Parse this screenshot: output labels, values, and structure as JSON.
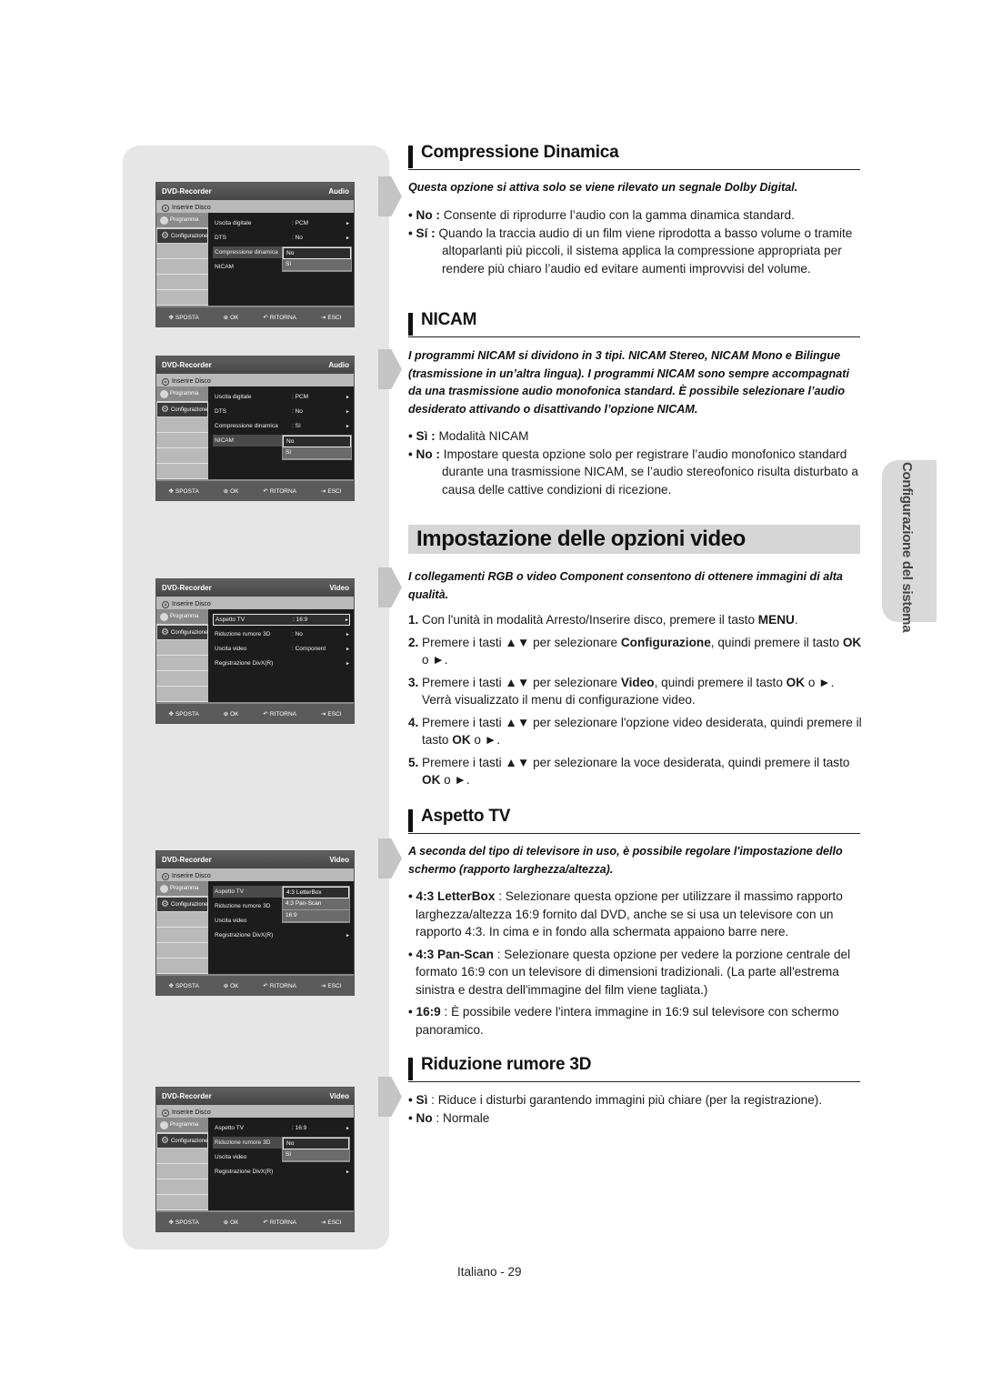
{
  "page": {
    "side_tab": "Configurazione del sistema",
    "page_number": "Italiano - 29"
  },
  "osd_common": {
    "app_title": "DVD-Recorder",
    "disc_label": "Inserire Disco",
    "tab_program": "Programma",
    "tab_setup": "Configurazione",
    "footer": {
      "move": "SPOSTA",
      "ok": "OK",
      "return": "RITORNA",
      "exit": "ESCI"
    }
  },
  "menus": [
    {
      "section": "Audio",
      "rows": [
        {
          "label": "Uscita digitale",
          "value": ": PCM",
          "arrow": "►"
        },
        {
          "label": "DTS",
          "value": ": No",
          "arrow": "►"
        },
        {
          "label": "Compressione dinamica",
          "value": "",
          "arrow": ""
        },
        {
          "label": "NICAM",
          "value": "",
          "arrow": ""
        }
      ],
      "popup_options": [
        "No",
        "Sì"
      ],
      "popup_selected": "No"
    },
    {
      "section": "Audio",
      "rows": [
        {
          "label": "Uscita digitale",
          "value": ": PCM",
          "arrow": "►"
        },
        {
          "label": "DTS",
          "value": ": No",
          "arrow": "►"
        },
        {
          "label": "Compressione dinamica",
          "value": ": Sì",
          "arrow": "►"
        },
        {
          "label": "NICAM",
          "value": "",
          "arrow": ""
        }
      ],
      "popup_options": [
        "No",
        "Sì"
      ],
      "popup_selected": "No"
    },
    {
      "section": "Video",
      "rows": [
        {
          "label": "Aspetto TV",
          "value": ": 16:9",
          "arrow": "►"
        },
        {
          "label": "Riduzione rumore 3D",
          "value": ": No",
          "arrow": "►"
        },
        {
          "label": "Uscita video",
          "value": ": Component",
          "arrow": "►"
        },
        {
          "label": "Registrazione DivX(R)",
          "value": "",
          "arrow": "►"
        }
      ]
    },
    {
      "section": "Video",
      "rows": [
        {
          "label": "Aspetto TV",
          "value": "",
          "arrow": ""
        },
        {
          "label": "Riduzione rumore 3D",
          "value": "",
          "arrow": ""
        },
        {
          "label": "Uscita video",
          "value": "",
          "arrow": ""
        },
        {
          "label": "Registrazione DivX(R)",
          "value": "",
          "arrow": "►"
        }
      ],
      "popup_options": [
        "4:3 LetterBox",
        "4:3 Pan-Scan",
        "16:9"
      ],
      "popup_selected": "4:3 LetterBox"
    },
    {
      "section": "Video",
      "rows": [
        {
          "label": "Aspetto TV",
          "value": ": 16:9",
          "arrow": "►"
        },
        {
          "label": "Riduzione rumore 3D",
          "value": "",
          "arrow": ""
        },
        {
          "label": "Uscita video",
          "value": "",
          "arrow": ""
        },
        {
          "label": "Registrazione DivX(R)",
          "value": "",
          "arrow": "►"
        }
      ],
      "popup_options": [
        "No",
        "Sì"
      ],
      "popup_selected": "No"
    }
  ],
  "compressione": {
    "title": "Compressione Dinamica",
    "intro": "Questa opzione si attiva solo se viene rilevato un segnale Dolby Digital.",
    "items": [
      {
        "key": "• No :",
        "text": "Consente di riprodurre l’audio con la gamma dinamica standard."
      },
      {
        "key": "• Sí :",
        "text": "Quando la traccia audio di un film viene riprodotta a basso volume o tramite altoparlanti più piccoli, il sistema applica la compressione appropriata per rendere più chiaro l’audio ed evitare aumenti improvvisi del volume."
      }
    ]
  },
  "nicam": {
    "title": "NICAM",
    "intro": "I programmi NICAM si dividono in 3 tipi. NICAM Stereo, NICAM Mono e Bilingue (trasmissione in un’altra lingua). I programmi NICAM sono sempre accompagnati da una trasmissione audio monofonica standard. È possibile selezionare l’audio desiderato attivando o disattivando l’opzione NICAM.",
    "items": [
      {
        "key": "• Sì :",
        "text": "Modalità NICAM"
      },
      {
        "key": "• No :",
        "text": "Impostare questa opzione solo per registrare l’audio monofonico standard durante una trasmissione NICAM, se l’audio stereofonico risulta disturbato a causa delle cattive condizioni di ricezione."
      }
    ]
  },
  "video": {
    "title": "Impostazione delle opzioni video",
    "intro": "I collegamenti RGB o video Component consentono di ottenere immagini di alta qualità.",
    "steps": [
      {
        "num": "1.",
        "pre": "Con l'unità in modalità Arresto/Inserire disco, premere il tasto ",
        "bold": "MENU",
        "post": "."
      },
      {
        "num": "2.",
        "pre": "Premere i tasti ▲▼ per selezionare ",
        "bold": "Configurazione",
        "post": ", quindi premere il tasto ",
        "bold2": "OK",
        "post2": " o ►."
      },
      {
        "num": "3.",
        "pre": "Premere i tasti ▲▼ per selezionare ",
        "bold": "Video",
        "post": ", quindi premere il tasto ",
        "bold2": "OK",
        "post2": " o ►. Verrà visualizzato il menu di configurazione video."
      },
      {
        "num": "4.",
        "pre": "Premere i tasti ▲▼ per selezionare l'opzione video desiderata, quindi premere il tasto ",
        "bold": "OK",
        "post": " o ►."
      },
      {
        "num": "5.",
        "pre": "Premere i tasti ▲▼ per selezionare la voce desiderata, quindi premere il tasto ",
        "bold": "OK",
        "post": " o ►."
      }
    ]
  },
  "aspetto": {
    "title": "Aspetto TV",
    "intro": "A seconda del tipo di televisore in uso, è possibile regolare l'impostazione dello schermo (rapporto larghezza/altezza).",
    "items": [
      {
        "key": "• 4:3 LetterBox",
        "text": " : Selezionare questa opzione per utilizzare il massimo rapporto larghezza/altezza 16:9 fornito dal DVD, anche se si usa un televisore con un rapporto 4:3. In cima e in fondo alla schermata appaiono barre nere."
      },
      {
        "key": "• 4:3 Pan-Scan",
        "text": " : Selezionare questa opzione per vedere la porzione centrale del formato 16:9 con un televisore di dimensioni tradizionali. (La parte all'estrema sinistra e destra dell'immagine del film viene tagliata.)"
      },
      {
        "key": "• 16:9",
        "text": " : È possibile vedere l'intera immagine in 16:9 sul televisore con schermo panoramico."
      }
    ]
  },
  "rumore": {
    "title": "Riduzione rumore 3D",
    "items": [
      {
        "key": "• Sì",
        "text": " : Riduce i disturbi garantendo immagini più chiare (per la registrazione)."
      },
      {
        "key": "• No",
        "text": " : Normale"
      }
    ]
  }
}
